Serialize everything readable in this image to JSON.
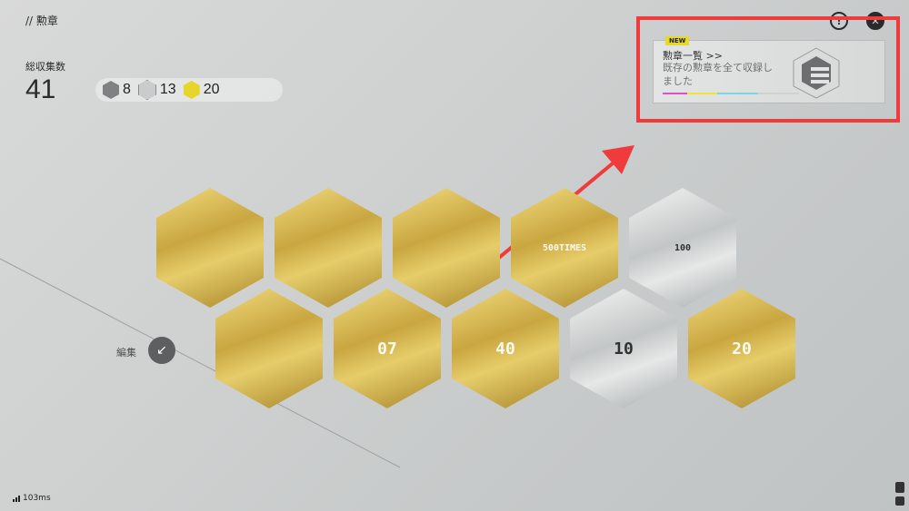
{
  "header": {
    "title": "// 勲章",
    "collection_label": "総収集数",
    "total_count": "41",
    "counts": [
      {
        "tier": "bronze",
        "value": "8",
        "color": "#8d8f90"
      },
      {
        "tier": "silver",
        "value": "13",
        "color": "#e9ebeb"
      },
      {
        "tier": "gold",
        "value": "20",
        "color": "#e7d62a"
      }
    ]
  },
  "top_buttons": {
    "info_icon": "info-icon",
    "close_icon": "close-icon"
  },
  "notification": {
    "badge": "NEW",
    "title": "勲章一覧 >>",
    "body": "既存の勲章を全て収録しました"
  },
  "medals": [
    {
      "tier": "gold",
      "text": ""
    },
    {
      "tier": "gold",
      "text": ""
    },
    {
      "tier": "gold",
      "text": ""
    },
    {
      "tier": "gold",
      "text": "500TIMES"
    },
    {
      "tier": "silver",
      "text": "100"
    },
    {
      "tier": "gold",
      "text": ""
    },
    {
      "tier": "gold",
      "text": "07"
    },
    {
      "tier": "gold",
      "text": "40"
    },
    {
      "tier": "silver",
      "text": "10"
    },
    {
      "tier": "gold",
      "text": "20"
    }
  ],
  "edit": {
    "label": "編集",
    "icon": "edit-icon"
  },
  "status": {
    "ping": "103ms"
  },
  "accent_colors": {
    "highlight": "#ef3b3b",
    "gold": "#e7d62a"
  }
}
